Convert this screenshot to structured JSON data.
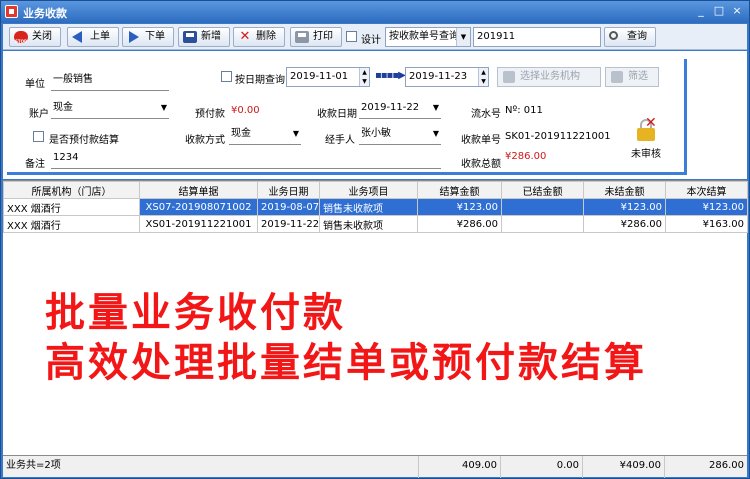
{
  "window": {
    "title": "业务收款",
    "minimize": "_",
    "maximize": "□",
    "close": "×"
  },
  "toolbar": {
    "close": "关闭",
    "prev": "上单",
    "next": "下单",
    "new": "新增",
    "delete": "删除",
    "print": "打印",
    "design": "设计",
    "query_mode": "按收款单号查询",
    "query_value": "201911",
    "query_button": "查询"
  },
  "form": {
    "unit_label": "单位",
    "unit_value": "一般销售",
    "date_query_label": "按日期查询",
    "date_from": "2019-11-01",
    "date_to": "2019-11-23",
    "arrow": "▪▪▪▪▶",
    "select_org_button": "选择业务机构",
    "filter_button": "筛选",
    "account_label": "账户",
    "account_value": "现金",
    "prepay_label": "预付款",
    "prepay_value": "¥0.00",
    "collect_date_label": "收款日期",
    "collect_date_value": "2019-11-22",
    "serial_label": "流水号",
    "serial_value": "Nº: 011",
    "is_prepay_label": "是否预付款结算",
    "method_label": "收款方式",
    "method_value": "现金",
    "handler_label": "经手人",
    "handler_value": "张小敏",
    "receipt_no_label": "收款单号",
    "receipt_no_value": "SK01-201911221001",
    "remark_label": "备注",
    "remark_value": "1234",
    "total_label": "收款总额",
    "total_value": "¥286.00",
    "audit_label": "未审核"
  },
  "table": {
    "headers": [
      "所属机构（门店）",
      "结算单据",
      "业务日期",
      "业务项目",
      "结算金额",
      "已结金额",
      "未结金额",
      "本次结算"
    ],
    "rows": [
      [
        "XXX 烟酒行",
        "XS07-201908071002",
        "2019-08-07",
        "销售未收款项",
        "¥123.00",
        "",
        "¥123.00",
        "¥123.00"
      ],
      [
        "XXX 烟酒行",
        "XS01-201911221001",
        "2019-11-22",
        "销售未收款项",
        "¥286.00",
        "",
        "¥286.00",
        "¥163.00"
      ]
    ]
  },
  "banner": {
    "line1": "批量业务收付款",
    "line2": "高效处理批量结单或预付款结算"
  },
  "footer": {
    "count": "业务共=2项",
    "settle_total": "409.00",
    "settled_total": "0.00",
    "unsettled_total": "¥409.00",
    "current_total": "286.00"
  },
  "colors": {
    "accent": "#3b7fd8",
    "highlight": "#f21616",
    "selected_row": "#2f6fd4"
  }
}
